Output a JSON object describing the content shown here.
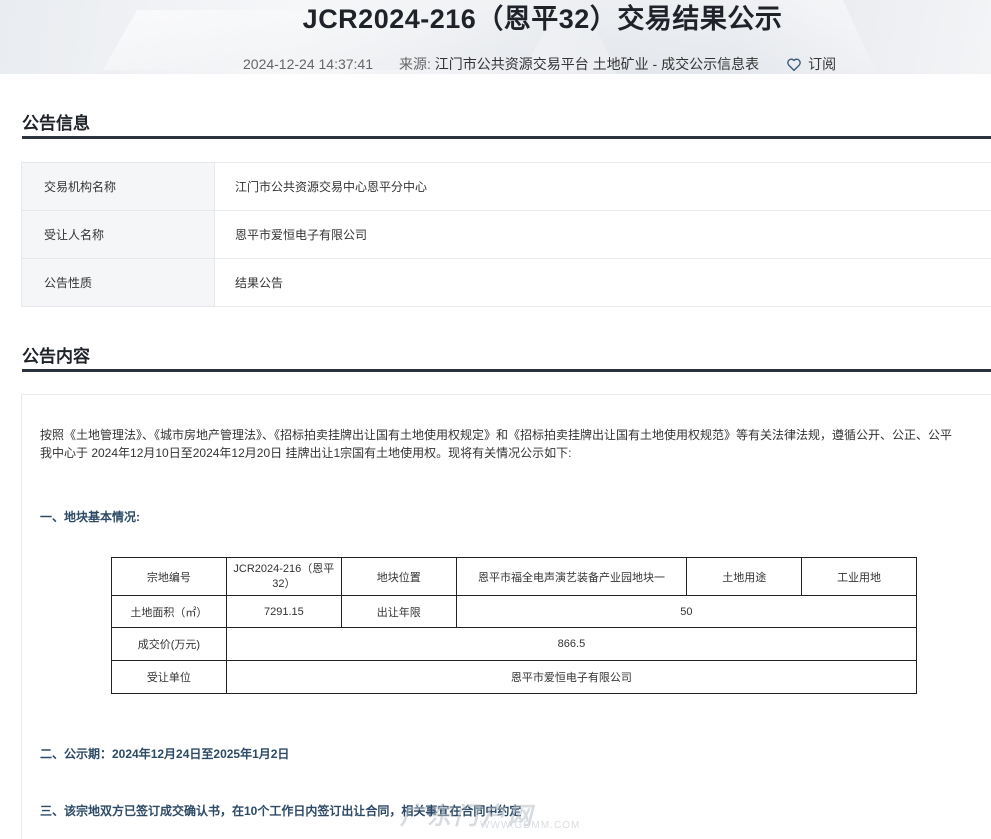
{
  "header": {
    "title": "JCR2024-216（恩平32）交易结果公示",
    "date": "2024-12-24 14:37:41",
    "source_label": "来源:",
    "source": "江门市公共资源交易平台 土地矿业 - 成交公示信息表",
    "subscribe_label": "订阅"
  },
  "section_info": {
    "title": "公告信息",
    "rows": [
      {
        "key": "交易机构名称",
        "value": "江门市公共资源交易中心恩平分中心"
      },
      {
        "key": "受让人名称",
        "value": "恩平市爱恒电子有限公司"
      },
      {
        "key": "公告性质",
        "value": "结果公告"
      }
    ]
  },
  "section_content": {
    "title": "公告内容",
    "para_line1": "按照《土地管理法》、《城市房地产管理法》、《招标拍卖挂牌出让国有土地使用权规定》和《招标拍卖挂牌出让国有土地使用权规范》等有关法律法规，遵循公开、公正、公平",
    "para_line2": "我中心于 2024年12月10日至2024年12月20日 挂牌出让1宗国有土地使用权。现将有关情况公示如下:",
    "heading1": "一、地块基本情况:",
    "heading2": "二、公示期：2024年12月24日至2025年1月2日",
    "heading3": "三、该宗地双方已签订成交确认书，在10个工作日内签订出让合同，相关事宜在合同中约定",
    "land_table": {
      "r1": {
        "k1": "宗地编号",
        "v1": "JCR2024-216（恩平32）",
        "k2": "地块位置",
        "v2": "恩平市福全电声演艺装备产业园地块一",
        "k3": "土地用途",
        "v3": "工业用地"
      },
      "r2": {
        "k1": "土地面积（㎡）",
        "v1": "7291.15",
        "k2": "出让年限",
        "v2": "50"
      },
      "r3": {
        "k": "成交价(万元)",
        "v": "866.5"
      },
      "r4": {
        "k": "受让单位",
        "v": "恩平市爱恒电子有限公司"
      }
    }
  },
  "watermark": {
    "big": "广东门户网",
    "small": "WWW.GDMM.COM"
  },
  "colors": {
    "heading_blue": "#2c4a66",
    "rule": "#2b3340"
  },
  "icons": {
    "subscribe": "heart-icon"
  }
}
